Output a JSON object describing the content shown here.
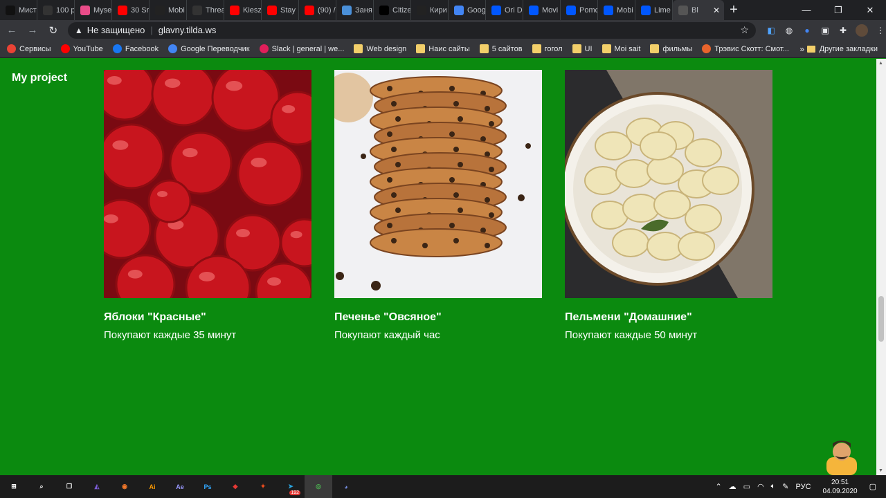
{
  "tabs": [
    {
      "label": "Мист",
      "icon": "lf-icon",
      "color": "#111111"
    },
    {
      "label": "100 р",
      "icon": "page-icon",
      "color": "#333333"
    },
    {
      "label": "Myse",
      "icon": "dribbble-icon",
      "color": "#ea4c89"
    },
    {
      "label": "30 Sr",
      "icon": "youtube-icon",
      "color": "#ff0000"
    },
    {
      "label": "Mobi",
      "icon": "behance-dark-icon",
      "color": "#222222"
    },
    {
      "label": "Threa",
      "icon": "threads-icon",
      "color": "#333333"
    },
    {
      "label": "Kiesz",
      "icon": "youtube-icon",
      "color": "#ff0000"
    },
    {
      "label": "Stay",
      "icon": "youtube-icon",
      "color": "#ff0000"
    },
    {
      "label": "(90) /",
      "icon": "youtube-icon",
      "color": "#ff0000"
    },
    {
      "label": "Заня",
      "icon": "cloud-icon",
      "color": "#4a90d9"
    },
    {
      "label": "Citize",
      "icon": "citizen-icon",
      "color": "#000000"
    },
    {
      "label": "Кири",
      "icon": "k-icon",
      "color": "#222222"
    },
    {
      "label": "Goog",
      "icon": "google-translate-icon",
      "color": "#4285f4"
    },
    {
      "label": "Ori D",
      "icon": "behance-icon",
      "color": "#0057ff"
    },
    {
      "label": "Movi",
      "icon": "behance-icon",
      "color": "#0057ff"
    },
    {
      "label": "Pomc",
      "icon": "behance-icon",
      "color": "#0057ff"
    },
    {
      "label": "Mobi",
      "icon": "behance-icon",
      "color": "#0057ff"
    },
    {
      "label": "Lime",
      "icon": "behance-icon",
      "color": "#0057ff"
    },
    {
      "label": "Bl",
      "icon": "tilda-icon",
      "color": "#555555",
      "active": true
    }
  ],
  "address": {
    "security_label": "Не защищено",
    "url": "glavny.tilda.ws"
  },
  "bookmarks": [
    {
      "label": "Сервисы",
      "icon": "apps-grid-icon",
      "color": "#ea4335"
    },
    {
      "label": "YouTube",
      "icon": "youtube-icon",
      "color": "#ff0000"
    },
    {
      "label": "Facebook",
      "icon": "facebook-icon",
      "color": "#1877f2"
    },
    {
      "label": "Google Переводчик",
      "icon": "google-translate-icon",
      "color": "#4285f4"
    },
    {
      "label": "Slack | general | we...",
      "icon": "slack-icon",
      "color": "#e01e5a"
    },
    {
      "label": "Web design",
      "icon": "folder-icon",
      "color": "#f2cf6a"
    },
    {
      "label": "Наис сайты",
      "icon": "folder-icon",
      "color": "#f2cf6a"
    },
    {
      "label": "5 сайтов",
      "icon": "folder-icon",
      "color": "#f2cf6a"
    },
    {
      "label": "гогол",
      "icon": "folder-icon",
      "color": "#f2cf6a"
    },
    {
      "label": "UI",
      "icon": "folder-icon",
      "color": "#f2cf6a"
    },
    {
      "label": "Moi sait",
      "icon": "folder-icon",
      "color": "#f2cf6a"
    },
    {
      "label": "фильмы",
      "icon": "folder-icon",
      "color": "#f2cf6a"
    },
    {
      "label": "Трэвис Скотт: Смот...",
      "icon": "f-icon",
      "color": "#e8642c"
    }
  ],
  "bookmarks_more": "»",
  "bookmarks_other": "Другие закладки",
  "page": {
    "logo": "My project",
    "background": "#0b8a0f",
    "cards": [
      {
        "title": "Яблоки \"Красные\"",
        "desc": "Покупают каждые 35 минут",
        "image": "apples-photo"
      },
      {
        "title": "Печенье \"Овсяное\"",
        "desc": "Покупают каждый час",
        "image": "cookies-photo"
      },
      {
        "title": "Пельмени \"Домашние\"",
        "desc": "Покупают каждые 50 минут",
        "image": "dumplings-photo"
      }
    ]
  },
  "taskbar": {
    "apps": [
      {
        "name": "start-icon",
        "label": "⊞",
        "color": "#ffffff"
      },
      {
        "name": "search-icon",
        "label": "⌕",
        "color": "#ffffff"
      },
      {
        "name": "task-view-icon",
        "label": "❐",
        "color": "#ffffff"
      },
      {
        "name": "vs-icon",
        "label": "◭",
        "color": "#7b5cd6"
      },
      {
        "name": "blender-icon",
        "label": "◉",
        "color": "#f5792a"
      },
      {
        "name": "illustrator-icon",
        "label": "Ai",
        "color": "#ff9a00"
      },
      {
        "name": "after-effects-icon",
        "label": "Ae",
        "color": "#9999ff"
      },
      {
        "name": "photoshop-icon",
        "label": "Ps",
        "color": "#31a8ff"
      },
      {
        "name": "shield-app-icon",
        "label": "◆",
        "color": "#e53935"
      },
      {
        "name": "figma-icon",
        "label": "✦",
        "color": "#f24e1e"
      },
      {
        "name": "telegram-icon",
        "label": "➤",
        "color": "#2aa3de",
        "badge": "192"
      },
      {
        "name": "chrome-icon",
        "label": "◎",
        "color": "#4caf50",
        "active": true
      },
      {
        "name": "discord-icon",
        "label": "◕",
        "color": "#7289da"
      }
    ],
    "language": "РУС",
    "time": "20:51",
    "date": "04.09.2020"
  }
}
